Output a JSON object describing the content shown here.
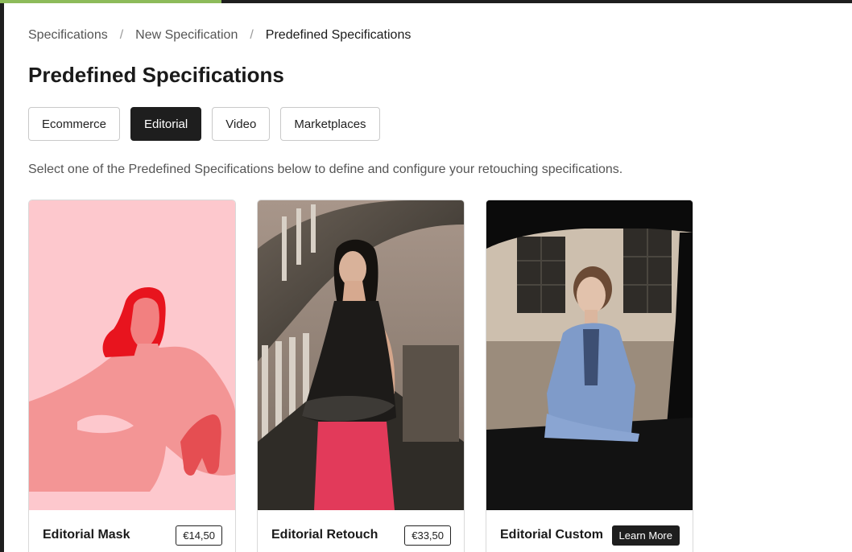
{
  "breadcrumb": {
    "items": [
      "Specifications",
      "New Specification",
      "Predefined Specifications"
    ],
    "separator": "/"
  },
  "page": {
    "title": "Predefined Specifications",
    "intro": "Select one of the Predefined Specifications below to define and configure your retouching specifications."
  },
  "tabs": [
    {
      "label": "Ecommerce",
      "active": false
    },
    {
      "label": "Editorial",
      "active": true
    },
    {
      "label": "Video",
      "active": false
    },
    {
      "label": "Marketplaces",
      "active": false
    }
  ],
  "cards": [
    {
      "name": "Editorial Mask",
      "price": "€14,50"
    },
    {
      "name": "Editorial Retouch",
      "price": "€33,50"
    },
    {
      "name": "Editorial Custom",
      "action": "Learn More"
    }
  ],
  "colors": {
    "progress": "#8dbb5a",
    "active_tab": "#1e1e1e",
    "mask_background": "#fdc8cd",
    "mask_figure": "#f08c8c",
    "mask_hair": "#e8141e"
  }
}
